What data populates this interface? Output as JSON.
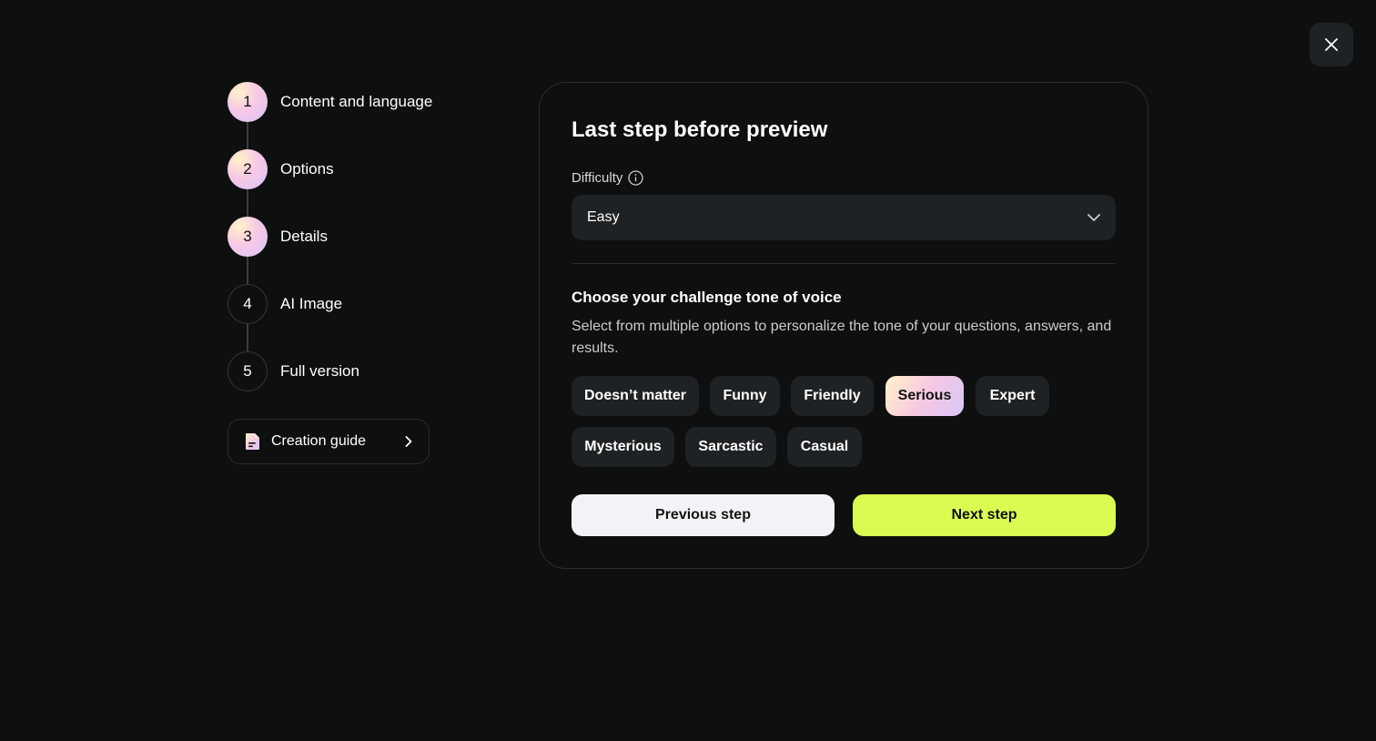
{
  "close_icon": "close-icon",
  "steps": [
    {
      "number": "1",
      "label": "Content and language",
      "state": "done"
    },
    {
      "number": "2",
      "label": "Options",
      "state": "done"
    },
    {
      "number": "3",
      "label": "Details",
      "state": "done"
    },
    {
      "number": "4",
      "label": "AI Image",
      "state": "todo"
    },
    {
      "number": "5",
      "label": "Full version",
      "state": "todo"
    }
  ],
  "guide": {
    "label": "Creation guide",
    "icon": "document-icon",
    "chevron": "chevron-right-icon"
  },
  "card": {
    "title": "Last step before preview",
    "difficulty": {
      "label": "Difficulty",
      "value": "Easy"
    },
    "tone": {
      "title": "Choose your challenge tone of voice",
      "description": "Select from multiple options to personalize the tone of your questions, answers, and results.",
      "options": [
        {
          "label": "Doesn’t matter",
          "selected": false
        },
        {
          "label": "Funny",
          "selected": false
        },
        {
          "label": "Friendly",
          "selected": false
        },
        {
          "label": "Serious",
          "selected": true
        },
        {
          "label": "Expert",
          "selected": false
        },
        {
          "label": "Mysterious",
          "selected": false
        },
        {
          "label": "Sarcastic",
          "selected": false
        },
        {
          "label": "Casual",
          "selected": false
        }
      ]
    },
    "prev_label": "Previous step",
    "next_label": "Next step"
  },
  "colors": {
    "accent": "#d9fb52",
    "background": "#0e0f0f",
    "surface": "#1f2224"
  }
}
